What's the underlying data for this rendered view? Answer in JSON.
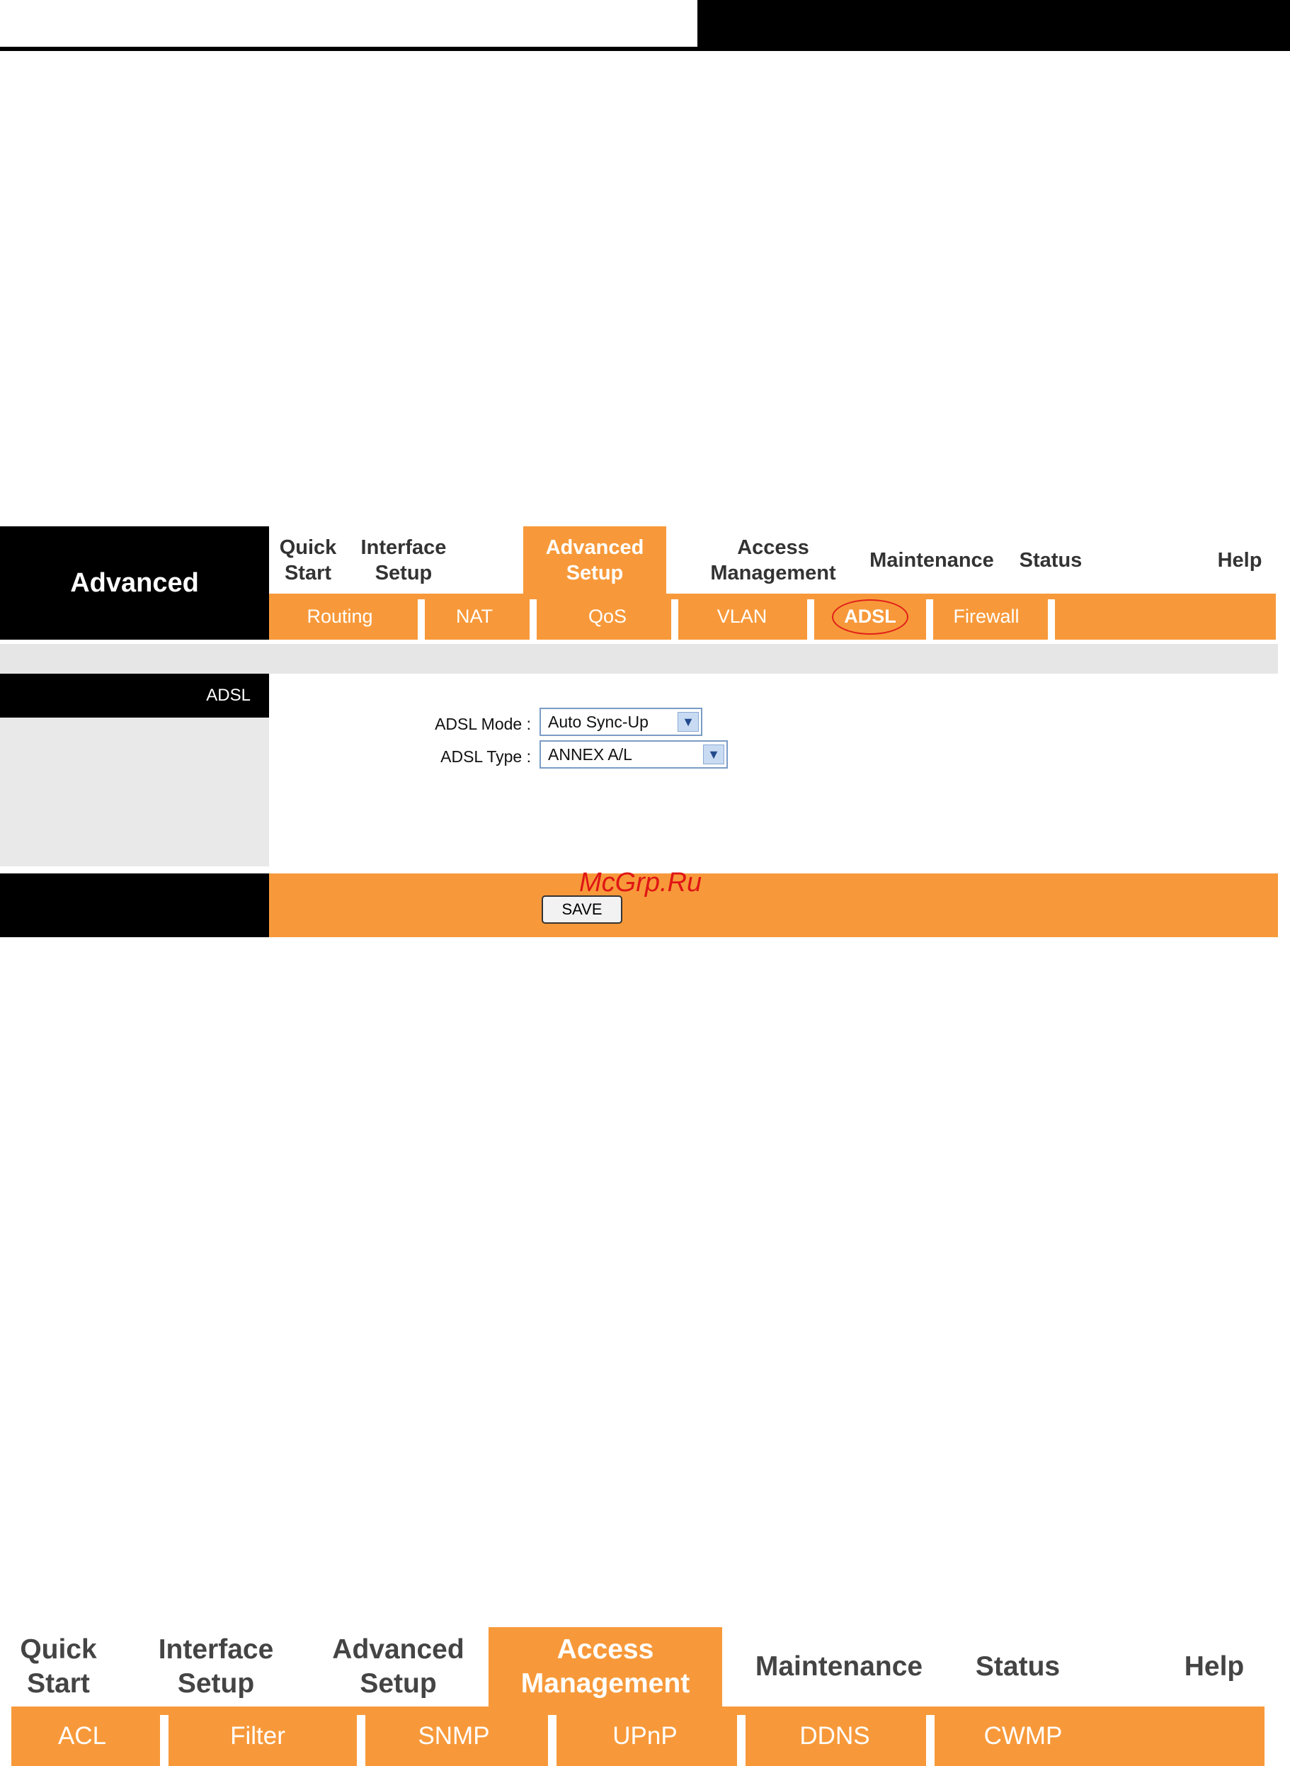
{
  "shot1": {
    "brand": "Advanced",
    "nav": [
      {
        "label": "Quick\nStart"
      },
      {
        "label": "Interface\nSetup"
      },
      {
        "label": "Advanced\nSetup"
      },
      {
        "label": "Access\nManagement"
      },
      {
        "label": "Maintenance"
      },
      {
        "label": "Status"
      },
      {
        "label": "Help"
      }
    ],
    "active_nav": "Advanced\nSetup",
    "subnav": [
      {
        "label": "Routing"
      },
      {
        "label": "NAT"
      },
      {
        "label": "QoS"
      },
      {
        "label": "VLAN"
      },
      {
        "label": "ADSL"
      },
      {
        "label": "Firewall"
      }
    ],
    "selected_subnav": "ADSL",
    "section_title": "ADSL",
    "form": {
      "mode_label": "ADSL Mode :",
      "mode_value": "Auto Sync-Up",
      "type_label": "ADSL Type :",
      "type_value": "ANNEX A/L"
    },
    "save_label": "SAVE",
    "watermark": "McGrp.Ru"
  },
  "shot2": {
    "nav": [
      {
        "label": "Quick\nStart"
      },
      {
        "label": "Interface\nSetup"
      },
      {
        "label": "Advanced\nSetup"
      },
      {
        "label": "Access\nManagement"
      },
      {
        "label": "Maintenance"
      },
      {
        "label": "Status"
      },
      {
        "label": "Help"
      }
    ],
    "active_nav": "Access\nManagement",
    "subnav": [
      {
        "label": "ACL"
      },
      {
        "label": "Filter"
      },
      {
        "label": "SNMP"
      },
      {
        "label": "UPnP"
      },
      {
        "label": "DDNS"
      },
      {
        "label": "CWMP"
      }
    ]
  },
  "colors": {
    "accent": "#f7993a",
    "dark": "#000000",
    "highlight_oval": "#e0201a"
  },
  "icons": {
    "dropdown": "chevron-down-icon"
  }
}
